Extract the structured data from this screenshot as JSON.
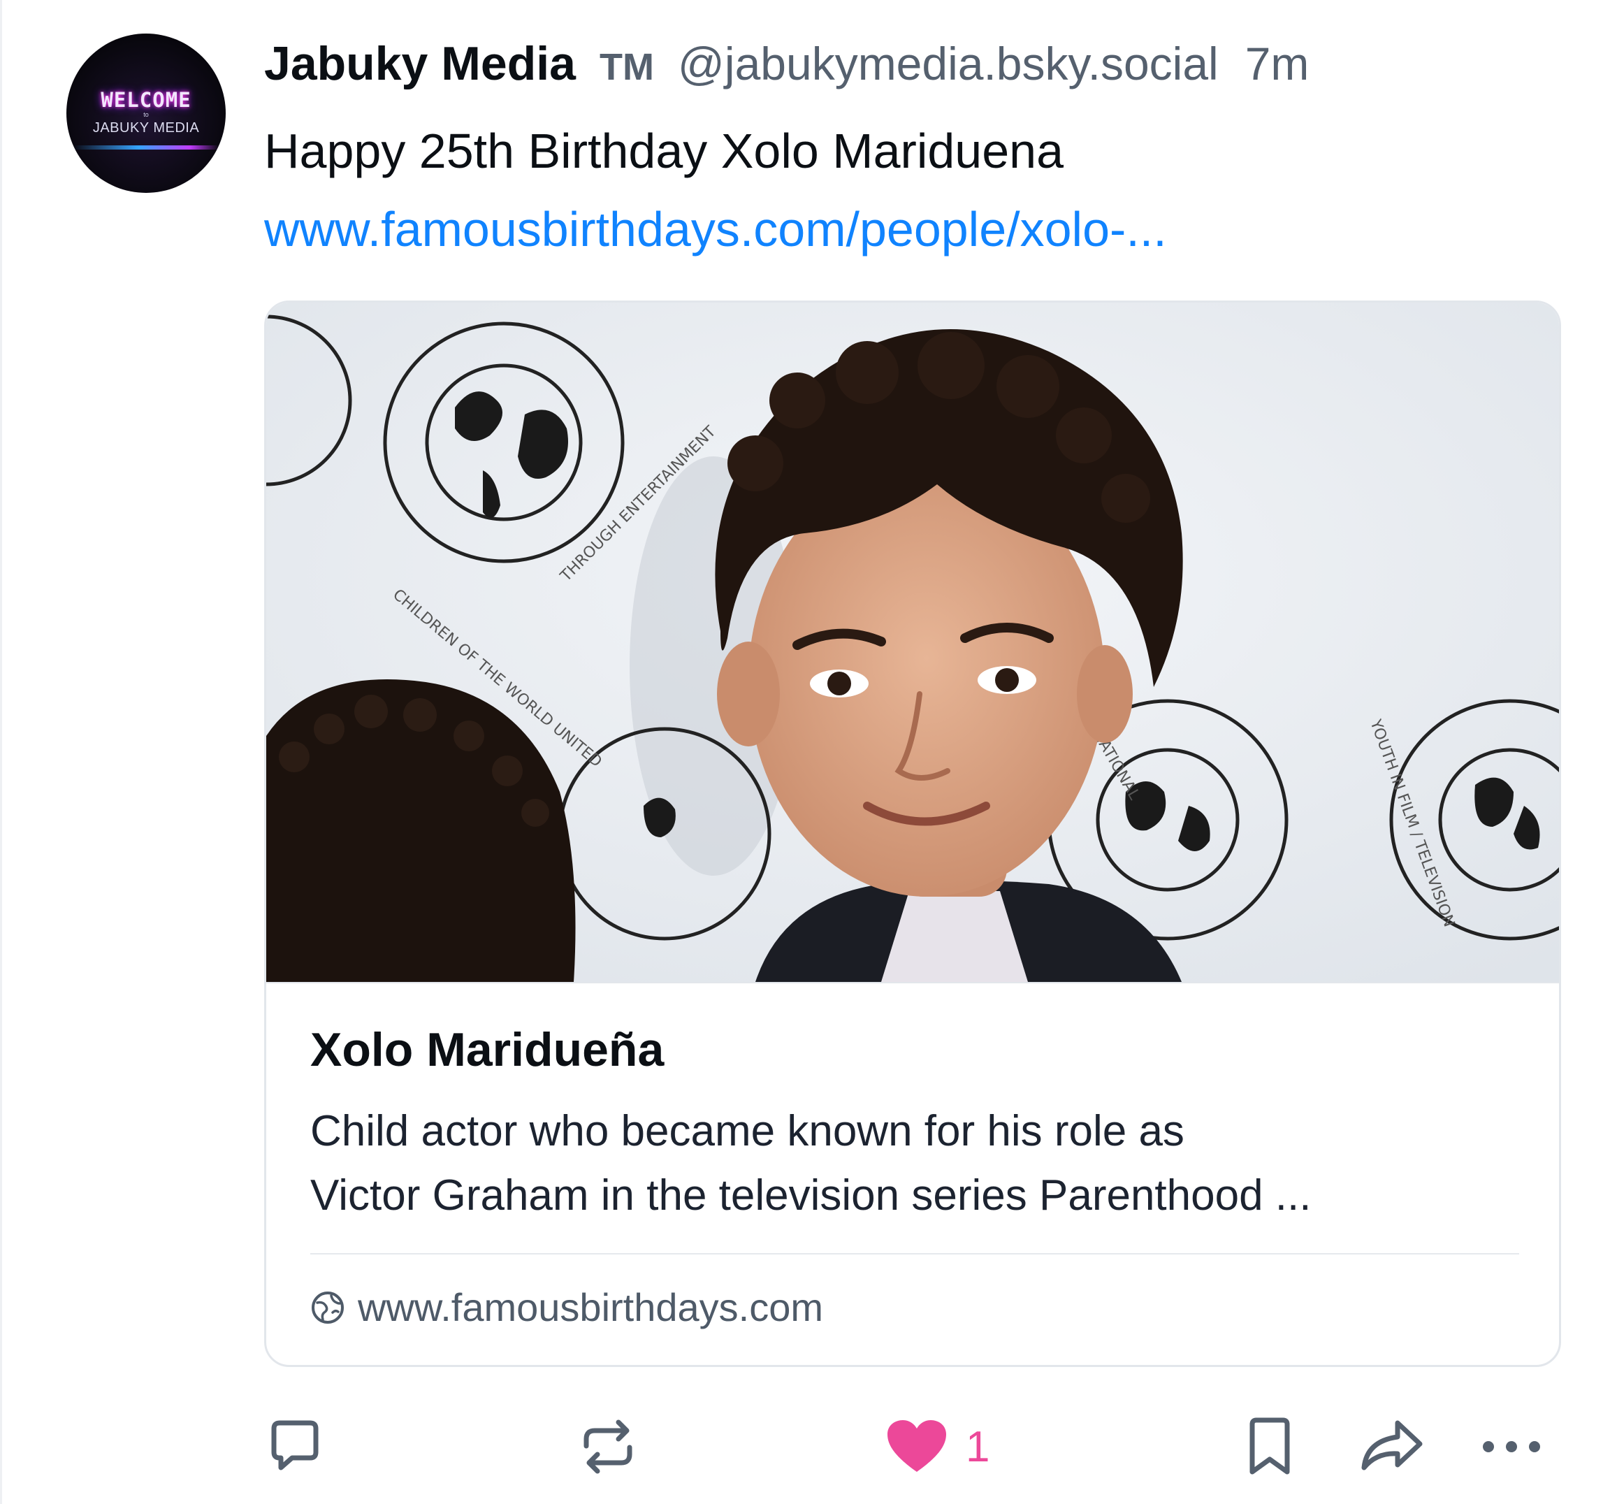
{
  "post": {
    "author": {
      "display_name": "Jabuky Media",
      "badge": "TM",
      "handle": "@jabukymedia.bsky.social",
      "avatar": {
        "line1": "WELCOME",
        "line2": "to",
        "line3": "JABUKY MEDIA"
      }
    },
    "timestamp": "7m",
    "text": "Happy 25th Birthday Xolo Mariduena",
    "link": "www.famousbirthdays.com/people/xolo-..."
  },
  "link_card": {
    "title": "Xolo Maridueña",
    "description_lines": [
      "Child actor who became known for his role as",
      "Victor Graham in the television series Parenthood ..."
    ],
    "domain": "www.famousbirthdays.com",
    "domain_icon": "globe-icon",
    "image_alt": "photo"
  },
  "actions": {
    "reply_icon": "reply-icon",
    "repost_icon": "repost-icon",
    "like_icon": "heart-icon",
    "like_count": "1",
    "bookmark_icon": "bookmark-icon",
    "share_icon": "share-icon",
    "more_icon": "more-icon"
  },
  "colors": {
    "link": "#1083fe",
    "muted": "#55606e",
    "like": "#ec4899",
    "text": "#0b0f14"
  }
}
